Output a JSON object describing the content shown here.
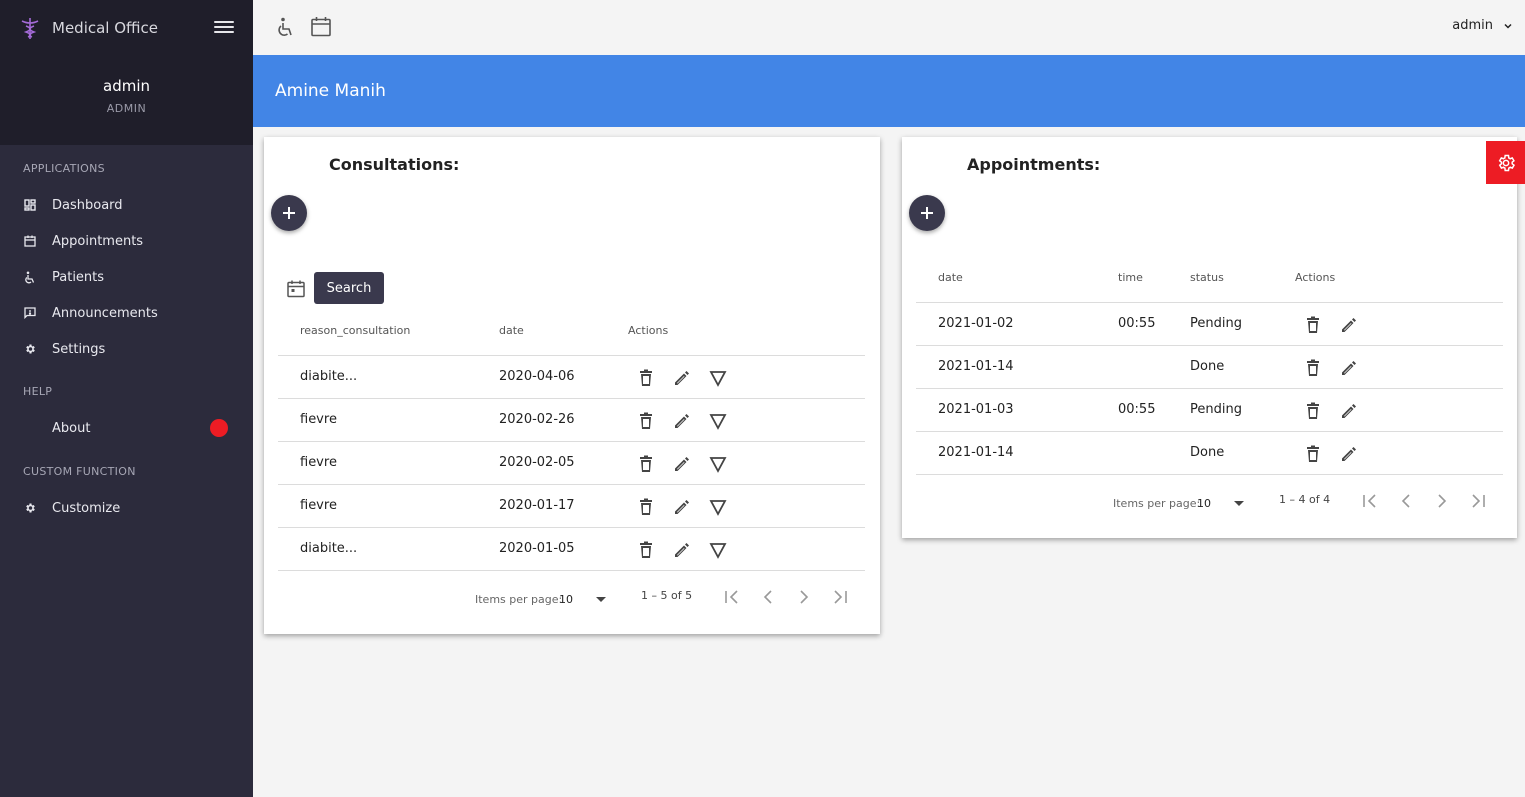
{
  "brand": {
    "title": "Medical Office",
    "logo_icon": "caduceus-icon"
  },
  "user": {
    "name": "admin",
    "role": "ADMIN"
  },
  "nav": {
    "sections": [
      {
        "label": "APPLICATIONS"
      },
      {
        "label": "HELP"
      },
      {
        "label": "CUSTOM FUNCTION"
      }
    ],
    "items": [
      {
        "label": "Dashboard",
        "icon": "dashboard-icon"
      },
      {
        "label": "Appointments",
        "icon": "calendar-icon"
      },
      {
        "label": "Patients",
        "icon": "wheelchair-icon"
      },
      {
        "label": "Announcements",
        "icon": "announcement-icon"
      },
      {
        "label": "Settings",
        "icon": "gear-icon"
      },
      {
        "label": "About",
        "icon": ""
      },
      {
        "label": "Customize",
        "icon": "gear-icon"
      }
    ]
  },
  "topbar": {
    "user_menu": "admin"
  },
  "banner": {
    "title": "Amine Manih"
  },
  "consultations": {
    "title": "Consultations:",
    "search_label": "Search",
    "columns": [
      "reason_consultation",
      "date",
      "Actions"
    ],
    "rows": [
      {
        "reason": "diabite...",
        "date": "2020-04-06"
      },
      {
        "reason": "fievre",
        "date": "2020-02-26"
      },
      {
        "reason": "fievre",
        "date": "2020-02-05"
      },
      {
        "reason": "fievre",
        "date": "2020-01-17"
      },
      {
        "reason": "diabite...",
        "date": "2020-01-05"
      }
    ],
    "pagination": {
      "items_per_page_label": "Items per page:",
      "page_size": "10",
      "range": "1 – 5 of 5"
    }
  },
  "appointments": {
    "title": "Appointments:",
    "columns": [
      "date",
      "time",
      "status",
      "Actions"
    ],
    "rows": [
      {
        "date": "2021-01-02",
        "time": "00:55",
        "status": "Pending"
      },
      {
        "date": "2021-01-14",
        "time": "",
        "status": "Done"
      },
      {
        "date": "2021-01-03",
        "time": "00:55",
        "status": "Pending"
      },
      {
        "date": "2021-01-14",
        "time": "",
        "status": "Done"
      }
    ],
    "pagination": {
      "items_per_page_label": "Items per page:",
      "page_size": "10",
      "range": "1 – 4 of 4"
    }
  },
  "colors": {
    "sidebar": "#2c2b3c",
    "sidebar_header": "#1f1e2a",
    "banner": "#4285e6",
    "fab": "#3a394d",
    "accent_red": "#ed1c24",
    "brand_logo": "#a46bd8"
  }
}
